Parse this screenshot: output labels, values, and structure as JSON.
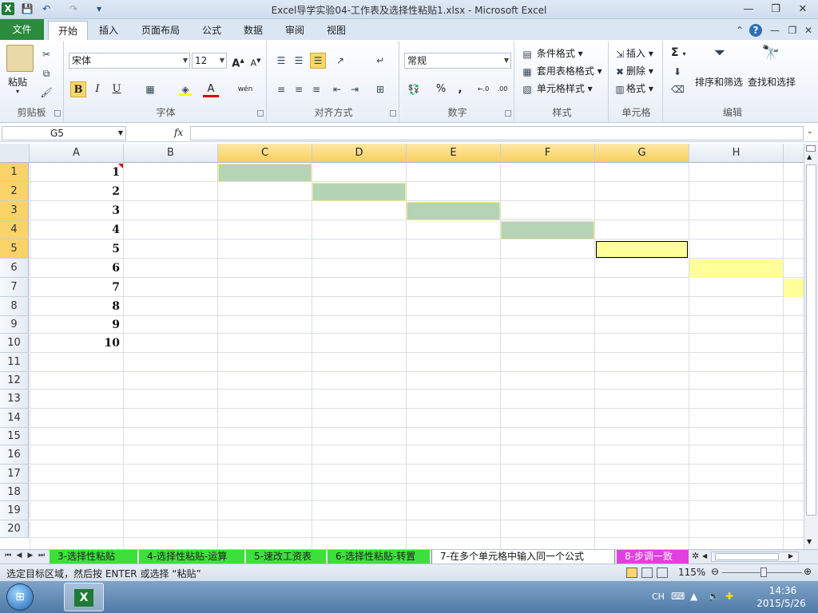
{
  "window": {
    "title": "Excel导学实验04-工作表及选择性粘贴1.xlsx - Microsoft Excel",
    "logo": "X"
  },
  "qat": {
    "save": "💾",
    "undo": "↶",
    "redo": "↷",
    "customize": "▾"
  },
  "window_buttons": {
    "minimize": "—",
    "restore": "❐",
    "close": "✕"
  },
  "tabs": {
    "file": "文件",
    "home": "开始",
    "insert": "插入",
    "page_layout": "页面布局",
    "formulas": "公式",
    "data": "数据",
    "review": "审阅",
    "view": "视图"
  },
  "ribbon": {
    "clipboard": {
      "label": "剪贴板",
      "paste": "粘贴"
    },
    "font": {
      "label": "字体",
      "name": "宋体",
      "size": "12",
      "bold": "B",
      "italic": "I",
      "underline": "U",
      "grow": "A",
      "shrink": "A",
      "font_color": "A",
      "wen": "wén"
    },
    "alignment": {
      "label": "对齐方式"
    },
    "number": {
      "label": "数字",
      "format": "常规",
      "percent": "%",
      "comma": ",",
      "inc_decimal": "←.0",
      "dec_decimal": ".00"
    },
    "styles": {
      "label": "样式",
      "conditional": "条件格式",
      "table_format": "套用表格格式",
      "cell_styles": "单元格样式"
    },
    "cells": {
      "label": "单元格",
      "insert": "插入",
      "delete": "删除",
      "format": "格式"
    },
    "editing": {
      "label": "编辑",
      "sum": "Σ",
      "sort_filter": "排序和筛选",
      "find_select": "查找和选择"
    }
  },
  "formula_bar": {
    "name_box": "G5",
    "fx": "fx"
  },
  "grid": {
    "columns": [
      "A",
      "B",
      "C",
      "D",
      "E",
      "F",
      "G",
      "H"
    ],
    "selected_columns": [
      "C",
      "D",
      "E",
      "F",
      "G"
    ],
    "rows": [
      "1",
      "2",
      "3",
      "4",
      "5",
      "6",
      "7",
      "8",
      "9",
      "10",
      "11",
      "12",
      "13",
      "14",
      "15",
      "16",
      "17",
      "18",
      "19",
      "20"
    ],
    "selected_rows": [
      "1",
      "2",
      "3",
      "4",
      "5"
    ],
    "col_a_values": [
      "1",
      "2",
      "3",
      "4",
      "5",
      "6",
      "7",
      "8",
      "9",
      "10"
    ]
  },
  "sheet_tabs": [
    {
      "label": "3-选择性粘贴",
      "style": "green"
    },
    {
      "label": "4-选择性粘贴-运算",
      "style": "green"
    },
    {
      "label": "5-速改工资表",
      "style": "green"
    },
    {
      "label": "6-选择性粘贴-转置",
      "style": "green"
    },
    {
      "label": "7-在多个单元格中输入同一个公式",
      "style": "active"
    },
    {
      "label": "8-步调一致",
      "style": "pink"
    }
  ],
  "status_bar": {
    "message": "选定目标区域，然后按 ENTER 或选择 “粘贴”",
    "zoom": "115%"
  },
  "taskbar": {
    "lang": "CH",
    "time": "14:36",
    "date": "2015/5/26"
  },
  "colors": {
    "accent_green": "#2a8b3c",
    "selected_header": "#f9cf5c",
    "copy_cell": "#b5d3b5",
    "paste_cell": "#ffff9a"
  }
}
